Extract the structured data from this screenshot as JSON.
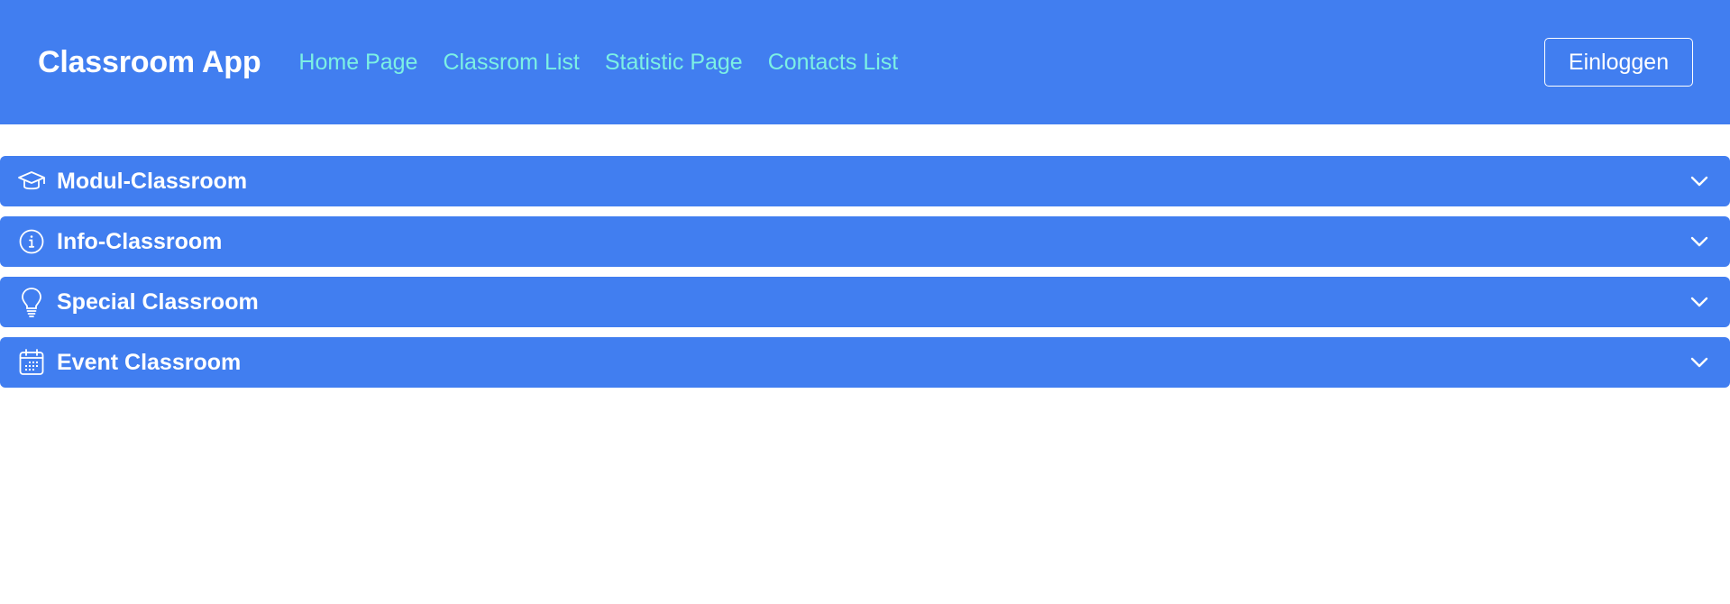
{
  "navbar": {
    "brand": "Classroom App",
    "links": [
      {
        "label": "Home Page"
      },
      {
        "label": "Classrom List"
      },
      {
        "label": "Statistic Page"
      },
      {
        "label": "Contacts List"
      }
    ],
    "login_label": "Einloggen"
  },
  "accordion": {
    "items": [
      {
        "title": "Modul-Classroom",
        "icon": "graduation-cap-icon"
      },
      {
        "title": "Info-Classroom",
        "icon": "info-icon"
      },
      {
        "title": "Special Classroom",
        "icon": "lightbulb-icon"
      },
      {
        "title": "Event Classroom",
        "icon": "calendar-icon"
      }
    ]
  },
  "colors": {
    "primary": "#417ef0",
    "link": "#7cf0e4",
    "text_light": "#ffffff"
  }
}
